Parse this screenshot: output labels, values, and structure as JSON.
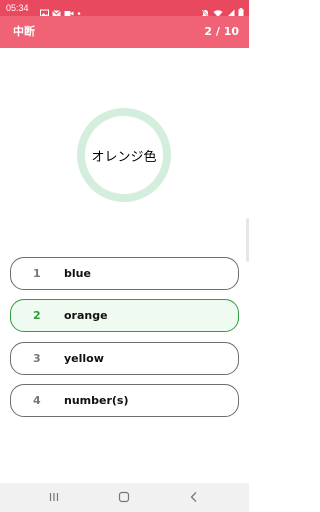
{
  "status_bar": {
    "time": "05:34",
    "icons": [
      "image-icon",
      "mail-icon",
      "video-icon",
      "dot-icon",
      "mute-icon",
      "wifi-icon",
      "signal-icon",
      "battery-icon"
    ]
  },
  "app_bar": {
    "quit_label": "中断",
    "progress_text": "2 / 10"
  },
  "question": {
    "word": "オレンジ色"
  },
  "options": [
    {
      "number": "1",
      "text": "blue",
      "selected": false
    },
    {
      "number": "2",
      "text": "orange",
      "selected": true
    },
    {
      "number": "3",
      "text": "yellow",
      "selected": false
    },
    {
      "number": "4",
      "text": "number(s)",
      "selected": false
    }
  ],
  "nav_bar": {
    "buttons": [
      "recents-icon",
      "home-icon",
      "back-icon"
    ]
  },
  "colors": {
    "app_bar": "#f06376",
    "status_bar": "#e8495e",
    "ring": "#d3eedd",
    "selected_border": "#2e9e3e",
    "selected_fill": "#effbf1"
  }
}
